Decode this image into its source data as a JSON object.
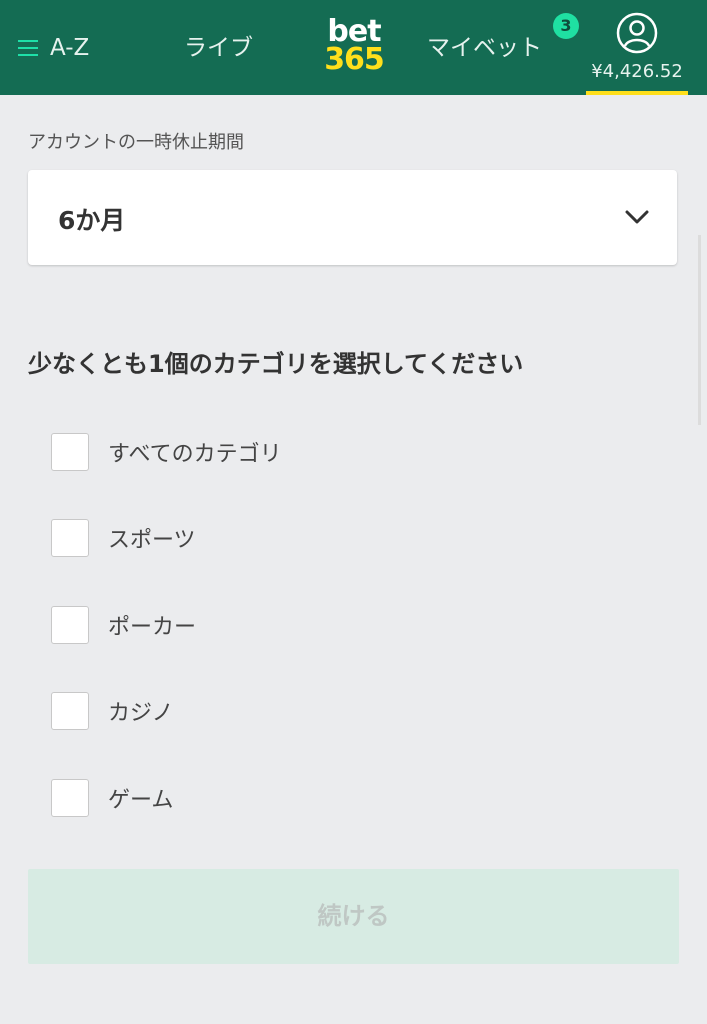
{
  "header": {
    "az_label": "A-Z",
    "live_label": "ライブ",
    "logo_top": "bet",
    "logo_bottom": "365",
    "mybets_label": "マイベット",
    "mybets_count": "3",
    "balance": "¥4,426.52"
  },
  "form": {
    "period_label": "アカウントの一時休止期間",
    "period_value": "6か月",
    "category_title": "少なくとも1個のカテゴリを選択してください",
    "categories": [
      {
        "label": "すべてのカテゴリ",
        "checked": false
      },
      {
        "label": "スポーツ",
        "checked": false
      },
      {
        "label": "ポーカー",
        "checked": false
      },
      {
        "label": "カジノ",
        "checked": false
      },
      {
        "label": "ゲーム",
        "checked": false
      }
    ],
    "continue_label": "続ける"
  },
  "colors": {
    "header_bg": "#146c53",
    "accent_green": "#1ee0a8",
    "logo_yellow": "#ffdf1b",
    "page_bg": "#ebecee",
    "continue_disabled_bg": "#d7ebe3"
  },
  "icons": [
    "hamburger-icon",
    "user-account-icon",
    "chevron-down-icon"
  ]
}
